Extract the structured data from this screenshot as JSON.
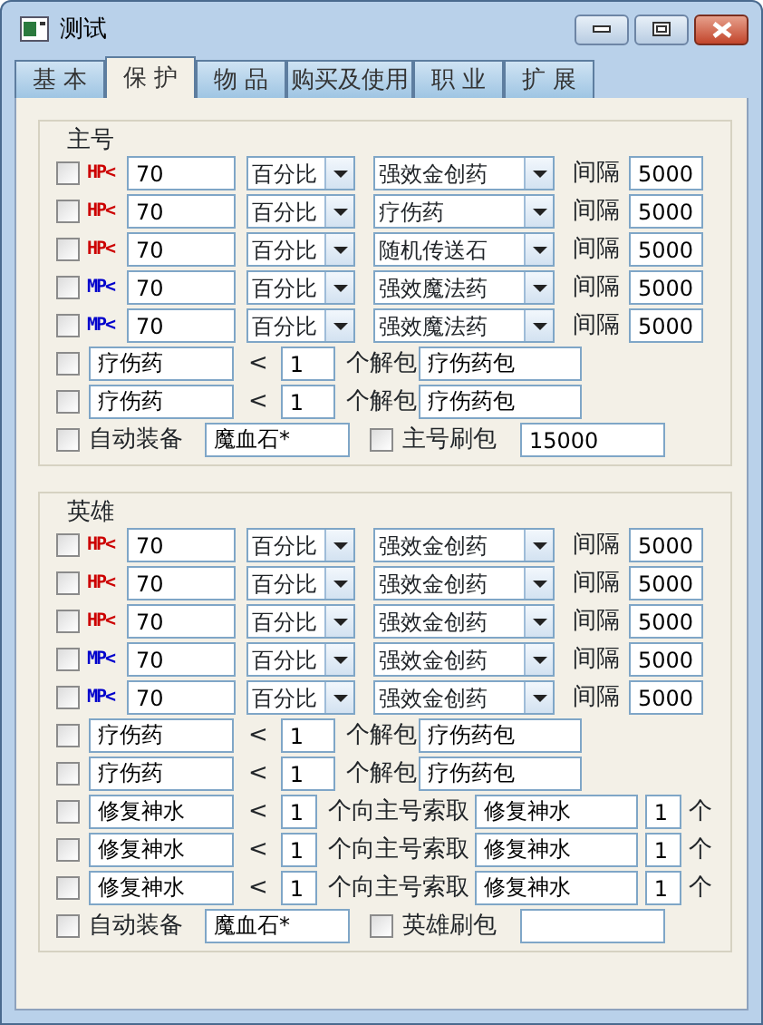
{
  "window": {
    "title": "测试"
  },
  "tabs": [
    {
      "label": "基 本",
      "selected": false
    },
    {
      "label": "保 护",
      "selected": true
    },
    {
      "label": "物 品",
      "selected": false
    },
    {
      "label": "购买及使用",
      "selected": false
    },
    {
      "label": "职 业",
      "selected": false
    },
    {
      "label": "扩 展",
      "selected": false
    }
  ],
  "groups": [
    {
      "title": "主号",
      "rows": [
        {
          "kind": "threshold",
          "checked": false,
          "stat": "HP<",
          "color": "#cc0000",
          "value": "70",
          "mode": "百分比",
          "item": "强效金创药",
          "interval_label": "间隔",
          "interval": "5000"
        },
        {
          "kind": "threshold",
          "checked": false,
          "stat": "HP<",
          "color": "#cc0000",
          "value": "70",
          "mode": "百分比",
          "item": "疗伤药",
          "interval_label": "间隔",
          "interval": "5000"
        },
        {
          "kind": "threshold",
          "checked": false,
          "stat": "HP<",
          "color": "#cc0000",
          "value": "70",
          "mode": "百分比",
          "item": "随机传送石",
          "interval_label": "间隔",
          "interval": "5000"
        },
        {
          "kind": "threshold",
          "checked": false,
          "stat": "MP<",
          "color": "#0000cc",
          "value": "70",
          "mode": "百分比",
          "item": "强效魔法药",
          "interval_label": "间隔",
          "interval": "5000"
        },
        {
          "kind": "threshold",
          "checked": false,
          "stat": "MP<",
          "color": "#0000cc",
          "value": "70",
          "mode": "百分比",
          "item": "强效魔法药",
          "interval_label": "间隔",
          "interval": "5000"
        },
        {
          "kind": "unpack",
          "checked": false,
          "item": "疗伤药",
          "op": "<",
          "count": "1",
          "action": "个解包",
          "target": "疗伤药包"
        },
        {
          "kind": "unpack",
          "checked": false,
          "item": "疗伤药",
          "op": "<",
          "count": "1",
          "action": "个解包",
          "target": "疗伤药包"
        },
        {
          "kind": "auto",
          "checked": false,
          "label": "自动装备",
          "value": "魔血石*",
          "refill_checked": false,
          "refill_label": "主号刷包",
          "refill_value": "15000"
        }
      ]
    },
    {
      "title": "英雄",
      "rows": [
        {
          "kind": "threshold",
          "checked": false,
          "stat": "HP<",
          "color": "#cc0000",
          "value": "70",
          "mode": "百分比",
          "item": "强效金创药",
          "interval_label": "间隔",
          "interval": "5000"
        },
        {
          "kind": "threshold",
          "checked": false,
          "stat": "HP<",
          "color": "#cc0000",
          "value": "70",
          "mode": "百分比",
          "item": "强效金创药",
          "interval_label": "间隔",
          "interval": "5000"
        },
        {
          "kind": "threshold",
          "checked": false,
          "stat": "HP<",
          "color": "#cc0000",
          "value": "70",
          "mode": "百分比",
          "item": "强效金创药",
          "interval_label": "间隔",
          "interval": "5000"
        },
        {
          "kind": "threshold",
          "checked": false,
          "stat": "MP<",
          "color": "#0000cc",
          "value": "70",
          "mode": "百分比",
          "item": "强效金创药",
          "interval_label": "间隔",
          "interval": "5000"
        },
        {
          "kind": "threshold",
          "checked": false,
          "stat": "MP<",
          "color": "#0000cc",
          "value": "70",
          "mode": "百分比",
          "item": "强效金创药",
          "interval_label": "间隔",
          "interval": "5000"
        },
        {
          "kind": "unpack",
          "checked": false,
          "item": "疗伤药",
          "op": "<",
          "count": "1",
          "action": "个解包",
          "target": "疗伤药包"
        },
        {
          "kind": "unpack",
          "checked": false,
          "item": "疗伤药",
          "op": "<",
          "count": "1",
          "action": "个解包",
          "target": "疗伤药包"
        },
        {
          "kind": "request",
          "checked": false,
          "item": "修复神水",
          "op": "<",
          "count": "1",
          "action": "个向主号索取",
          "target": "修复神水",
          "qty": "1",
          "unit": "个"
        },
        {
          "kind": "request",
          "checked": false,
          "item": "修复神水",
          "op": "<",
          "count": "1",
          "action": "个向主号索取",
          "target": "修复神水",
          "qty": "1",
          "unit": "个"
        },
        {
          "kind": "request",
          "checked": false,
          "item": "修复神水",
          "op": "<",
          "count": "1",
          "action": "个向主号索取",
          "target": "修复神水",
          "qty": "1",
          "unit": "个"
        },
        {
          "kind": "auto",
          "checked": false,
          "label": "自动装备",
          "value": "魔血石*",
          "refill_checked": false,
          "refill_label": "英雄刷包"
        }
      ]
    }
  ]
}
